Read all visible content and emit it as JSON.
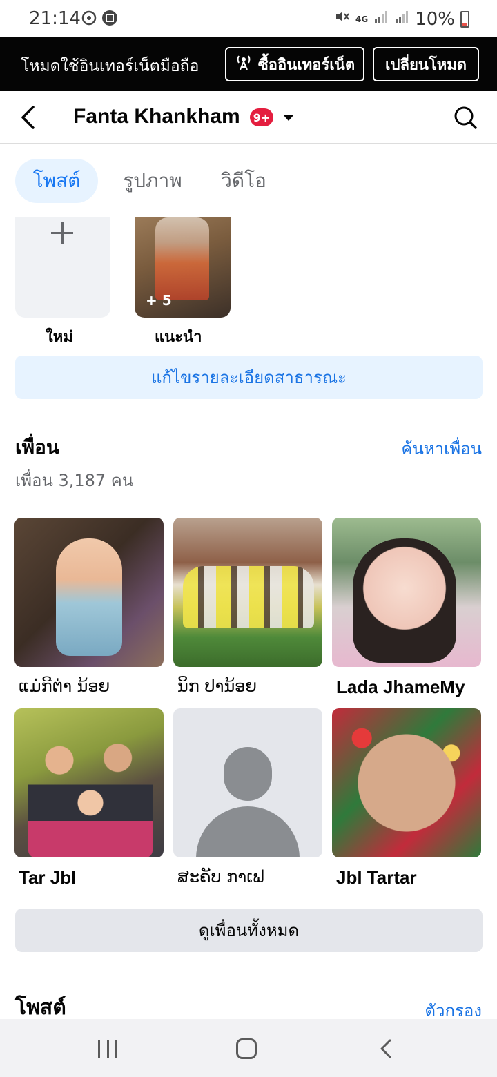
{
  "status_bar": {
    "time": "21:14",
    "network": "4G",
    "battery": "10%"
  },
  "data_banner": {
    "label": "โหมดใช้อินเทอร์เน็ตมือถือ",
    "buy_button": "ซื้ออินเทอร์เน็ต",
    "switch_button": "เปลี่ยนโหมด"
  },
  "header": {
    "title": "Fanta Khankham",
    "badge": "9+"
  },
  "tabs": [
    {
      "label": "โพสต์",
      "active": true
    },
    {
      "label": "รูปภาพ",
      "active": false
    },
    {
      "label": "วิดีโอ",
      "active": false
    }
  ],
  "highlights": {
    "new_label": "ใหม่",
    "recommended_label": "แนะนำ",
    "recommended_count": "+ 5"
  },
  "edit_details_label": "แก้ไขรายละเอียดสาธารณะ",
  "friends": {
    "title": "เพื่อน",
    "find_link": "ค้นหาเพื่อน",
    "count": "เพื่อน 3,187 คน",
    "list": [
      {
        "name": "ແມ່ກີຕ່າ ນ້ອຍ"
      },
      {
        "name": "ນິກ ປານ້ອຍ"
      },
      {
        "name": "Lada JhameMy"
      },
      {
        "name": "Tar Jbl"
      },
      {
        "name": "ສະຄັບ ກາເຟ"
      },
      {
        "name": "Jbl Tartar"
      }
    ],
    "see_all": "ดูเพื่อนทั้งหมด"
  },
  "posts": {
    "title": "โพสต์",
    "filter": "ตัวกรอง"
  },
  "colors": {
    "accent": "#1b74e4",
    "badge": "#e41e3f",
    "banner_bg": "#050505"
  }
}
